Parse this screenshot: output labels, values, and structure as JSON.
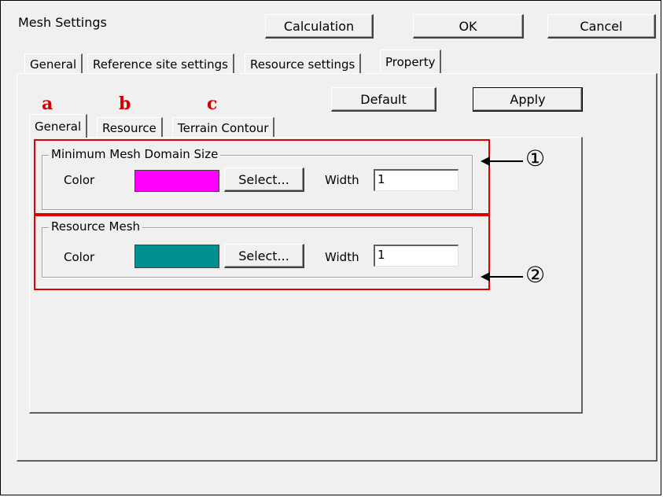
{
  "dialog": {
    "title": "Mesh Settings",
    "buttons": {
      "calculation": "Calculation",
      "ok": "OK",
      "cancel": "Cancel"
    }
  },
  "top_tabs": [
    "General",
    "Reference site settings",
    "Resource settings",
    "Property"
  ],
  "property": {
    "default_label": "Default",
    "apply_label": "Apply",
    "sub_tabs": [
      "General",
      "Resource",
      "Terrain Contour"
    ],
    "annotation_letters": [
      "a",
      "b",
      "c"
    ],
    "groups": [
      {
        "legend": "Minimum Mesh Domain Size",
        "color_label": "Color",
        "color": "#ff00ff",
        "select_label": "Select...",
        "width_label": "Width",
        "width_value": "1",
        "marker": "①"
      },
      {
        "legend": "Resource Mesh",
        "color_label": "Color",
        "color": "#009090",
        "select_label": "Select...",
        "width_label": "Width",
        "width_value": "1",
        "marker": "②"
      }
    ]
  },
  "colors": {
    "annotation_red": "#e00000",
    "dialog_bg": "#f0f0f0"
  }
}
